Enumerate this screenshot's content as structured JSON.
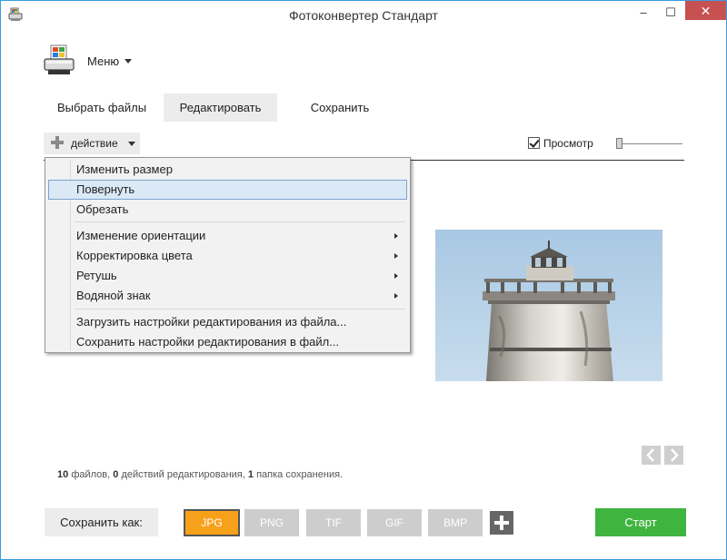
{
  "window": {
    "title": "Фотоконвертер Стандарт",
    "minimize": "–",
    "maximize": "☐",
    "close": "✕"
  },
  "menu": {
    "label": "Меню"
  },
  "tabs": [
    {
      "label": "Выбрать файлы"
    },
    {
      "label": "Редактировать"
    },
    {
      "label": "Сохранить"
    }
  ],
  "toolbar": {
    "action_label": "действие",
    "preview_label": "Просмотр",
    "preview_checked": true
  },
  "dropdown": {
    "items": [
      {
        "label": "Изменить размер",
        "has_submenu": false
      },
      {
        "label": "Повернуть",
        "has_submenu": false,
        "highlighted": true
      },
      {
        "label": "Обрезать",
        "has_submenu": false
      },
      {
        "label": "Изменение ориентации",
        "has_submenu": true
      },
      {
        "label": "Корректировка цвета",
        "has_submenu": true
      },
      {
        "label": "Ретушь",
        "has_submenu": true
      },
      {
        "label": "Водяной знак",
        "has_submenu": true
      },
      {
        "label": "Загрузить настройки редактирования из файла...",
        "has_submenu": false
      },
      {
        "label": "Сохранить настройки редактирования в файл...",
        "has_submenu": false
      }
    ]
  },
  "status": {
    "files_count": "10",
    "files_text": "файлов,",
    "actions_count": "0",
    "actions_text": "действий редактирования,",
    "folders_count": "1",
    "folders_text": "папка сохранения."
  },
  "bottom": {
    "save_as_label": "Сохранить как:",
    "formats": [
      "JPG",
      "PNG",
      "TIF",
      "GIF",
      "BMP"
    ],
    "selected_format": "JPG",
    "start_label": "Старт"
  },
  "colors": {
    "accent_selected_format": "#f7a11a",
    "start_button": "#3fb53f",
    "close_button": "#c75050",
    "menu_highlight": "#dbe9f7"
  }
}
